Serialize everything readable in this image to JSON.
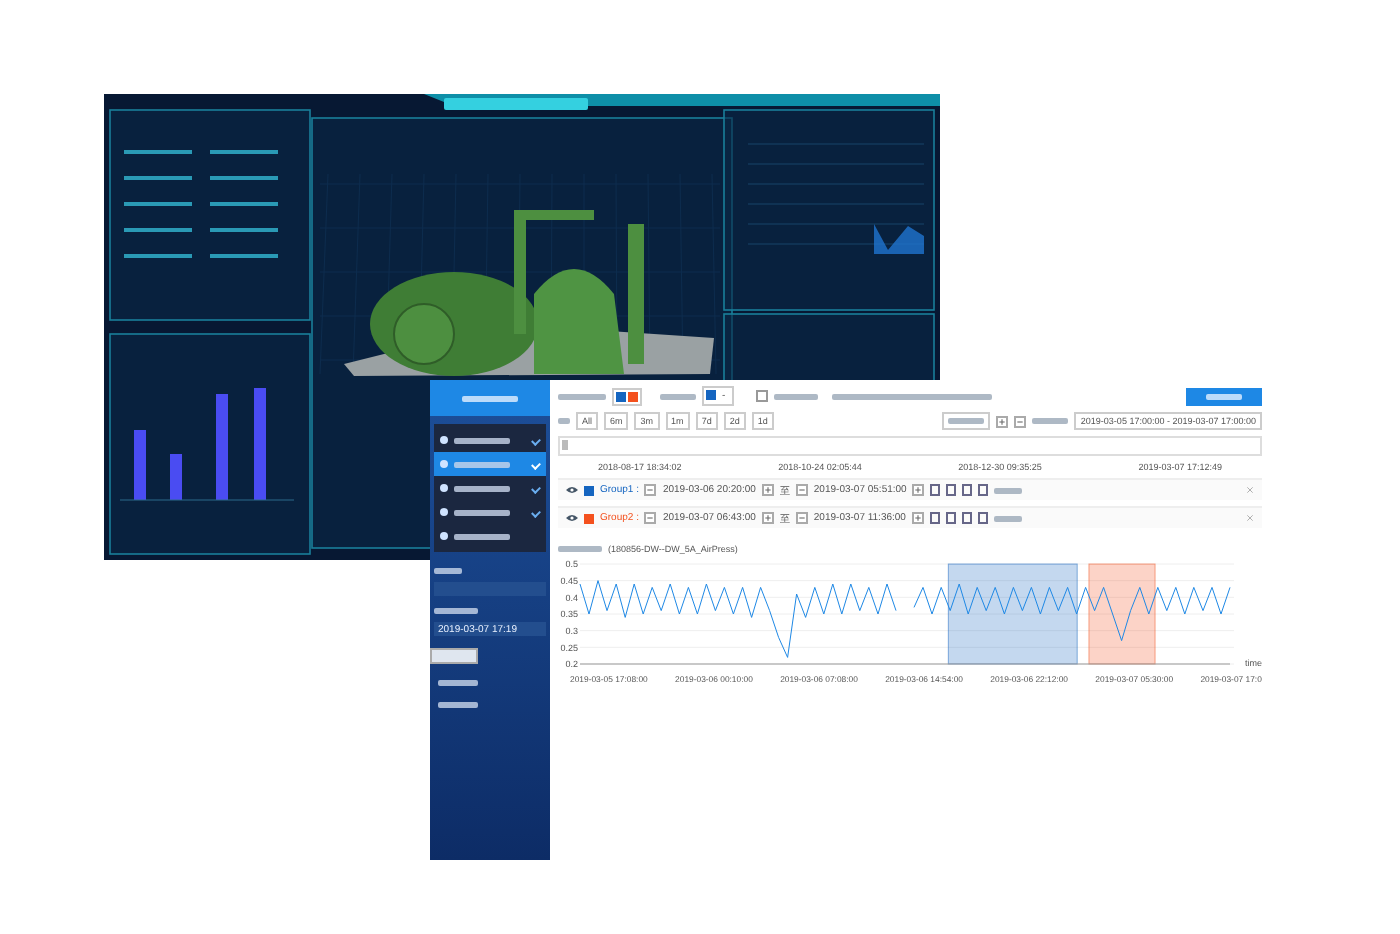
{
  "app": {
    "sidebar": {
      "steps": [
        {
          "checked": true,
          "selected": false
        },
        {
          "checked": true,
          "selected": true
        },
        {
          "checked": true,
          "selected": false
        },
        {
          "checked": true,
          "selected": false
        },
        {
          "checked": false,
          "selected": false
        }
      ],
      "start_time_value": "2019-03-07 17:19"
    },
    "toolbar": {
      "selected_colors": [
        {
          "color": "#1565c0"
        },
        {
          "color": "#f4511e"
        }
      ],
      "current_color": {
        "color": "#1565c0"
      },
      "current_color_caret": "-",
      "interval_checkbox": {
        "checked": false
      }
    },
    "range_buttons": [
      "All",
      "6m",
      "3m",
      "1m",
      "7d",
      "2d",
      "1d"
    ],
    "date_range": "2019-03-05 17:00:00 - 2019-03-07 17:00:00",
    "navigator_dates": [
      "2018-08-17 18:34:02",
      "2018-10-24 02:05:44",
      "2018-12-30 09:35:25",
      "2019-03-07 17:12:49"
    ],
    "groups": [
      {
        "name": "Group1 :",
        "color": "#1565c0",
        "start": "2019-03-06 20:20:00",
        "to": "至",
        "end": "2019-03-07 05:51:00"
      },
      {
        "name": "Group2 :",
        "color": "#f4511e",
        "start": "2019-03-07 06:43:00",
        "to": "至",
        "end": "2019-03-07 11:36:00"
      }
    ],
    "chart": {
      "tag": "(180856-DW--DW_5A_AirPress)",
      "x_axis_labels": [
        "2019-03-05 17:08:00",
        "2019-03-06 00:10:00",
        "2019-03-06 07:08:00",
        "2019-03-06 14:54:00",
        "2019-03-06 22:12:00",
        "2019-03-07 05:30:00",
        "2019-03-07 17:0"
      ],
      "chart_data": {
        "type": "line",
        "xlabel": "time",
        "ylim": [
          0.2,
          0.5
        ],
        "grid": true,
        "yticks": [
          {
            "value": 0.5,
            "label": "0.5"
          },
          {
            "value": 0.45,
            "label": "0.45"
          },
          {
            "value": 0.4,
            "label": "0.4"
          },
          {
            "value": 0.35,
            "label": "0.35"
          },
          {
            "value": 0.3,
            "label": "0.3"
          },
          {
            "value": 0.25,
            "label": "0.25"
          },
          {
            "value": 0.2,
            "label": "0.2"
          }
        ],
        "series": [
          {
            "color": "#1e88e5",
            "values": [
              0.44,
              0.35,
              0.45,
              0.36,
              0.44,
              0.34,
              0.44,
              0.35,
              0.43,
              0.36,
              0.44,
              0.35,
              0.43,
              0.35,
              0.44,
              0.36,
              0.43,
              0.35,
              0.43,
              0.34,
              0.43,
              0.36,
              0.28,
              0.22,
              0.41,
              0.34,
              0.43,
              0.35,
              0.44,
              0.35,
              0.44,
              0.36,
              0.43,
              0.35,
              0.44,
              0.36,
              null,
              0.37,
              0.43,
              0.35,
              0.43,
              0.36,
              0.44,
              0.35,
              0.43,
              0.36,
              0.43,
              0.35,
              0.43,
              0.36,
              0.43,
              0.35,
              0.43,
              0.36,
              0.43,
              0.35,
              0.43,
              0.36,
              0.43,
              0.35,
              0.27,
              0.36,
              0.43,
              0.35,
              0.43,
              0.36,
              0.43,
              0.35,
              0.43,
              0.36,
              0.43,
              0.35,
              0.43
            ]
          }
        ]
      }
    }
  }
}
